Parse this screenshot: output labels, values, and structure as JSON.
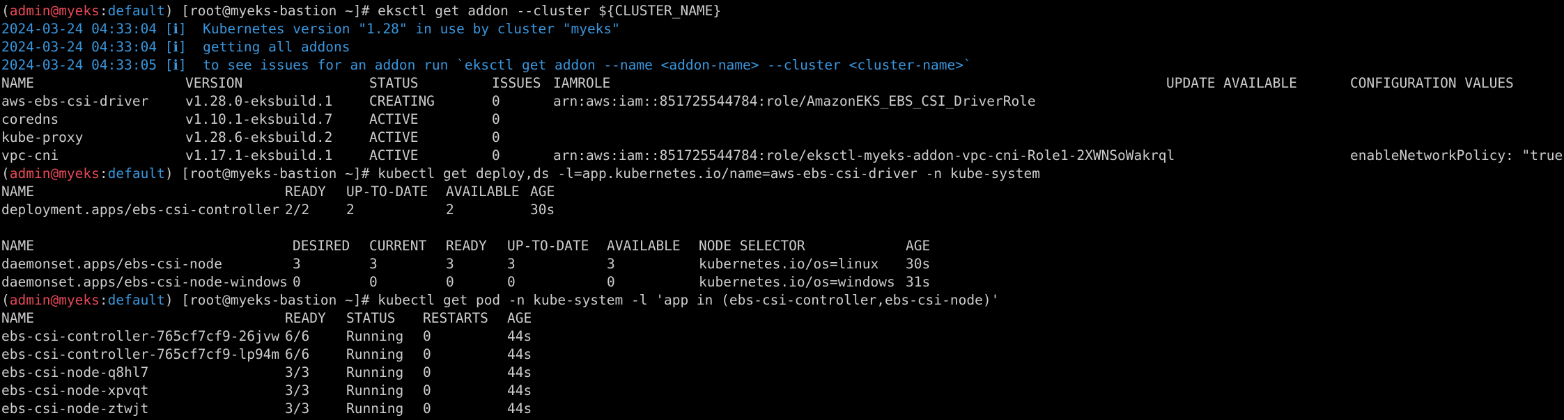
{
  "colors": {
    "background": "#000000",
    "foreground": "#cccccc",
    "prompt_user": "#e74856",
    "prompt_context": "#3a96dd",
    "info": "#3a96dd"
  },
  "lines": [
    {
      "type": "prompt",
      "open": "(",
      "user": "admin@myeks",
      "sep": ":",
      "context": "default",
      "rest": ") [root@myeks-bastion ~]# eksctl get addon --cluster ${CLUSTER_NAME}"
    },
    {
      "type": "info",
      "text": "2024-03-24 04:33:04 [ℹ]  Kubernetes version \"1.28\" in use by cluster \"myeks\""
    },
    {
      "type": "info",
      "text": "2024-03-24 04:33:04 [ℹ]  getting all addons"
    },
    {
      "type": "info",
      "text": "2024-03-24 04:33:05 [ℹ]  to see issues for an addon run `eksctl get addon --name <addon-name> --cluster <cluster-name>`"
    },
    {
      "type": "row",
      "table": "addons",
      "cells": [
        "NAME",
        "VERSION",
        "STATUS",
        "ISSUES",
        "IAMROLE",
        "UPDATE AVAILABLE",
        "CONFIGURATION VALUES"
      ]
    },
    {
      "type": "row",
      "table": "addons",
      "cells": [
        "aws-ebs-csi-driver",
        "v1.28.0-eksbuild.1",
        "CREATING",
        "0",
        "arn:aws:iam::851725544784:role/AmazonEKS_EBS_CSI_DriverRole",
        "",
        ""
      ]
    },
    {
      "type": "row",
      "table": "addons",
      "cells": [
        "coredns",
        "v1.10.1-eksbuild.7",
        "ACTIVE",
        "0",
        "",
        "",
        ""
      ]
    },
    {
      "type": "row",
      "table": "addons",
      "cells": [
        "kube-proxy",
        "v1.28.6-eksbuild.2",
        "ACTIVE",
        "0",
        "",
        "",
        ""
      ]
    },
    {
      "type": "row",
      "table": "addons",
      "cells": [
        "vpc-cni",
        "v1.17.1-eksbuild.1",
        "ACTIVE",
        "0",
        "arn:aws:iam::851725544784:role/eksctl-myeks-addon-vpc-cni-Role1-2XWNSoWakrql",
        "",
        "enableNetworkPolicy: \"true\""
      ]
    },
    {
      "type": "prompt",
      "open": "(",
      "user": "admin@myeks",
      "sep": ":",
      "context": "default",
      "rest": ") [root@myeks-bastion ~]# kubectl get deploy,ds -l=app.kubernetes.io/name=aws-ebs-csi-driver -n kube-system"
    },
    {
      "type": "row",
      "table": "deploy",
      "cells": [
        "NAME",
        "READY",
        "UP-TO-DATE",
        "AVAILABLE",
        "AGE"
      ]
    },
    {
      "type": "row",
      "table": "deploy",
      "cells": [
        "deployment.apps/ebs-csi-controller",
        "2/2",
        "2",
        "2",
        "30s"
      ]
    },
    {
      "type": "blank"
    },
    {
      "type": "row",
      "table": "ds",
      "cells": [
        "NAME",
        "DESIRED",
        "CURRENT",
        "READY",
        "UP-TO-DATE",
        "AVAILABLE",
        "NODE SELECTOR",
        "AGE"
      ]
    },
    {
      "type": "row",
      "table": "ds",
      "cells": [
        "daemonset.apps/ebs-csi-node",
        "3",
        "3",
        "3",
        "3",
        "3",
        "kubernetes.io/os=linux",
        "30s"
      ]
    },
    {
      "type": "row",
      "table": "ds",
      "cells": [
        "daemonset.apps/ebs-csi-node-windows",
        "0",
        "0",
        "0",
        "0",
        "0",
        "kubernetes.io/os=windows",
        "31s"
      ]
    },
    {
      "type": "prompt",
      "open": "(",
      "user": "admin@myeks",
      "sep": ":",
      "context": "default",
      "rest": ") [root@myeks-bastion ~]# kubectl get pod -n kube-system -l 'app in (ebs-csi-controller,ebs-csi-node)'"
    },
    {
      "type": "row",
      "table": "pods",
      "cells": [
        "NAME",
        "READY",
        "STATUS",
        "RESTARTS",
        "AGE"
      ]
    },
    {
      "type": "row",
      "table": "pods",
      "cells": [
        "ebs-csi-controller-765cf7cf9-26jvw",
        "6/6",
        "Running",
        "0",
        "44s"
      ]
    },
    {
      "type": "row",
      "table": "pods",
      "cells": [
        "ebs-csi-controller-765cf7cf9-lp94m",
        "6/6",
        "Running",
        "0",
        "44s"
      ]
    },
    {
      "type": "row",
      "table": "pods",
      "cells": [
        "ebs-csi-node-q8hl7",
        "3/3",
        "Running",
        "0",
        "44s"
      ]
    },
    {
      "type": "row",
      "table": "pods",
      "cells": [
        "ebs-csi-node-xpvqt",
        "3/3",
        "Running",
        "0",
        "44s"
      ]
    },
    {
      "type": "row",
      "table": "pods",
      "cells": [
        "ebs-csi-node-ztwjt",
        "3/3",
        "Running",
        "0",
        "44s"
      ]
    }
  ]
}
